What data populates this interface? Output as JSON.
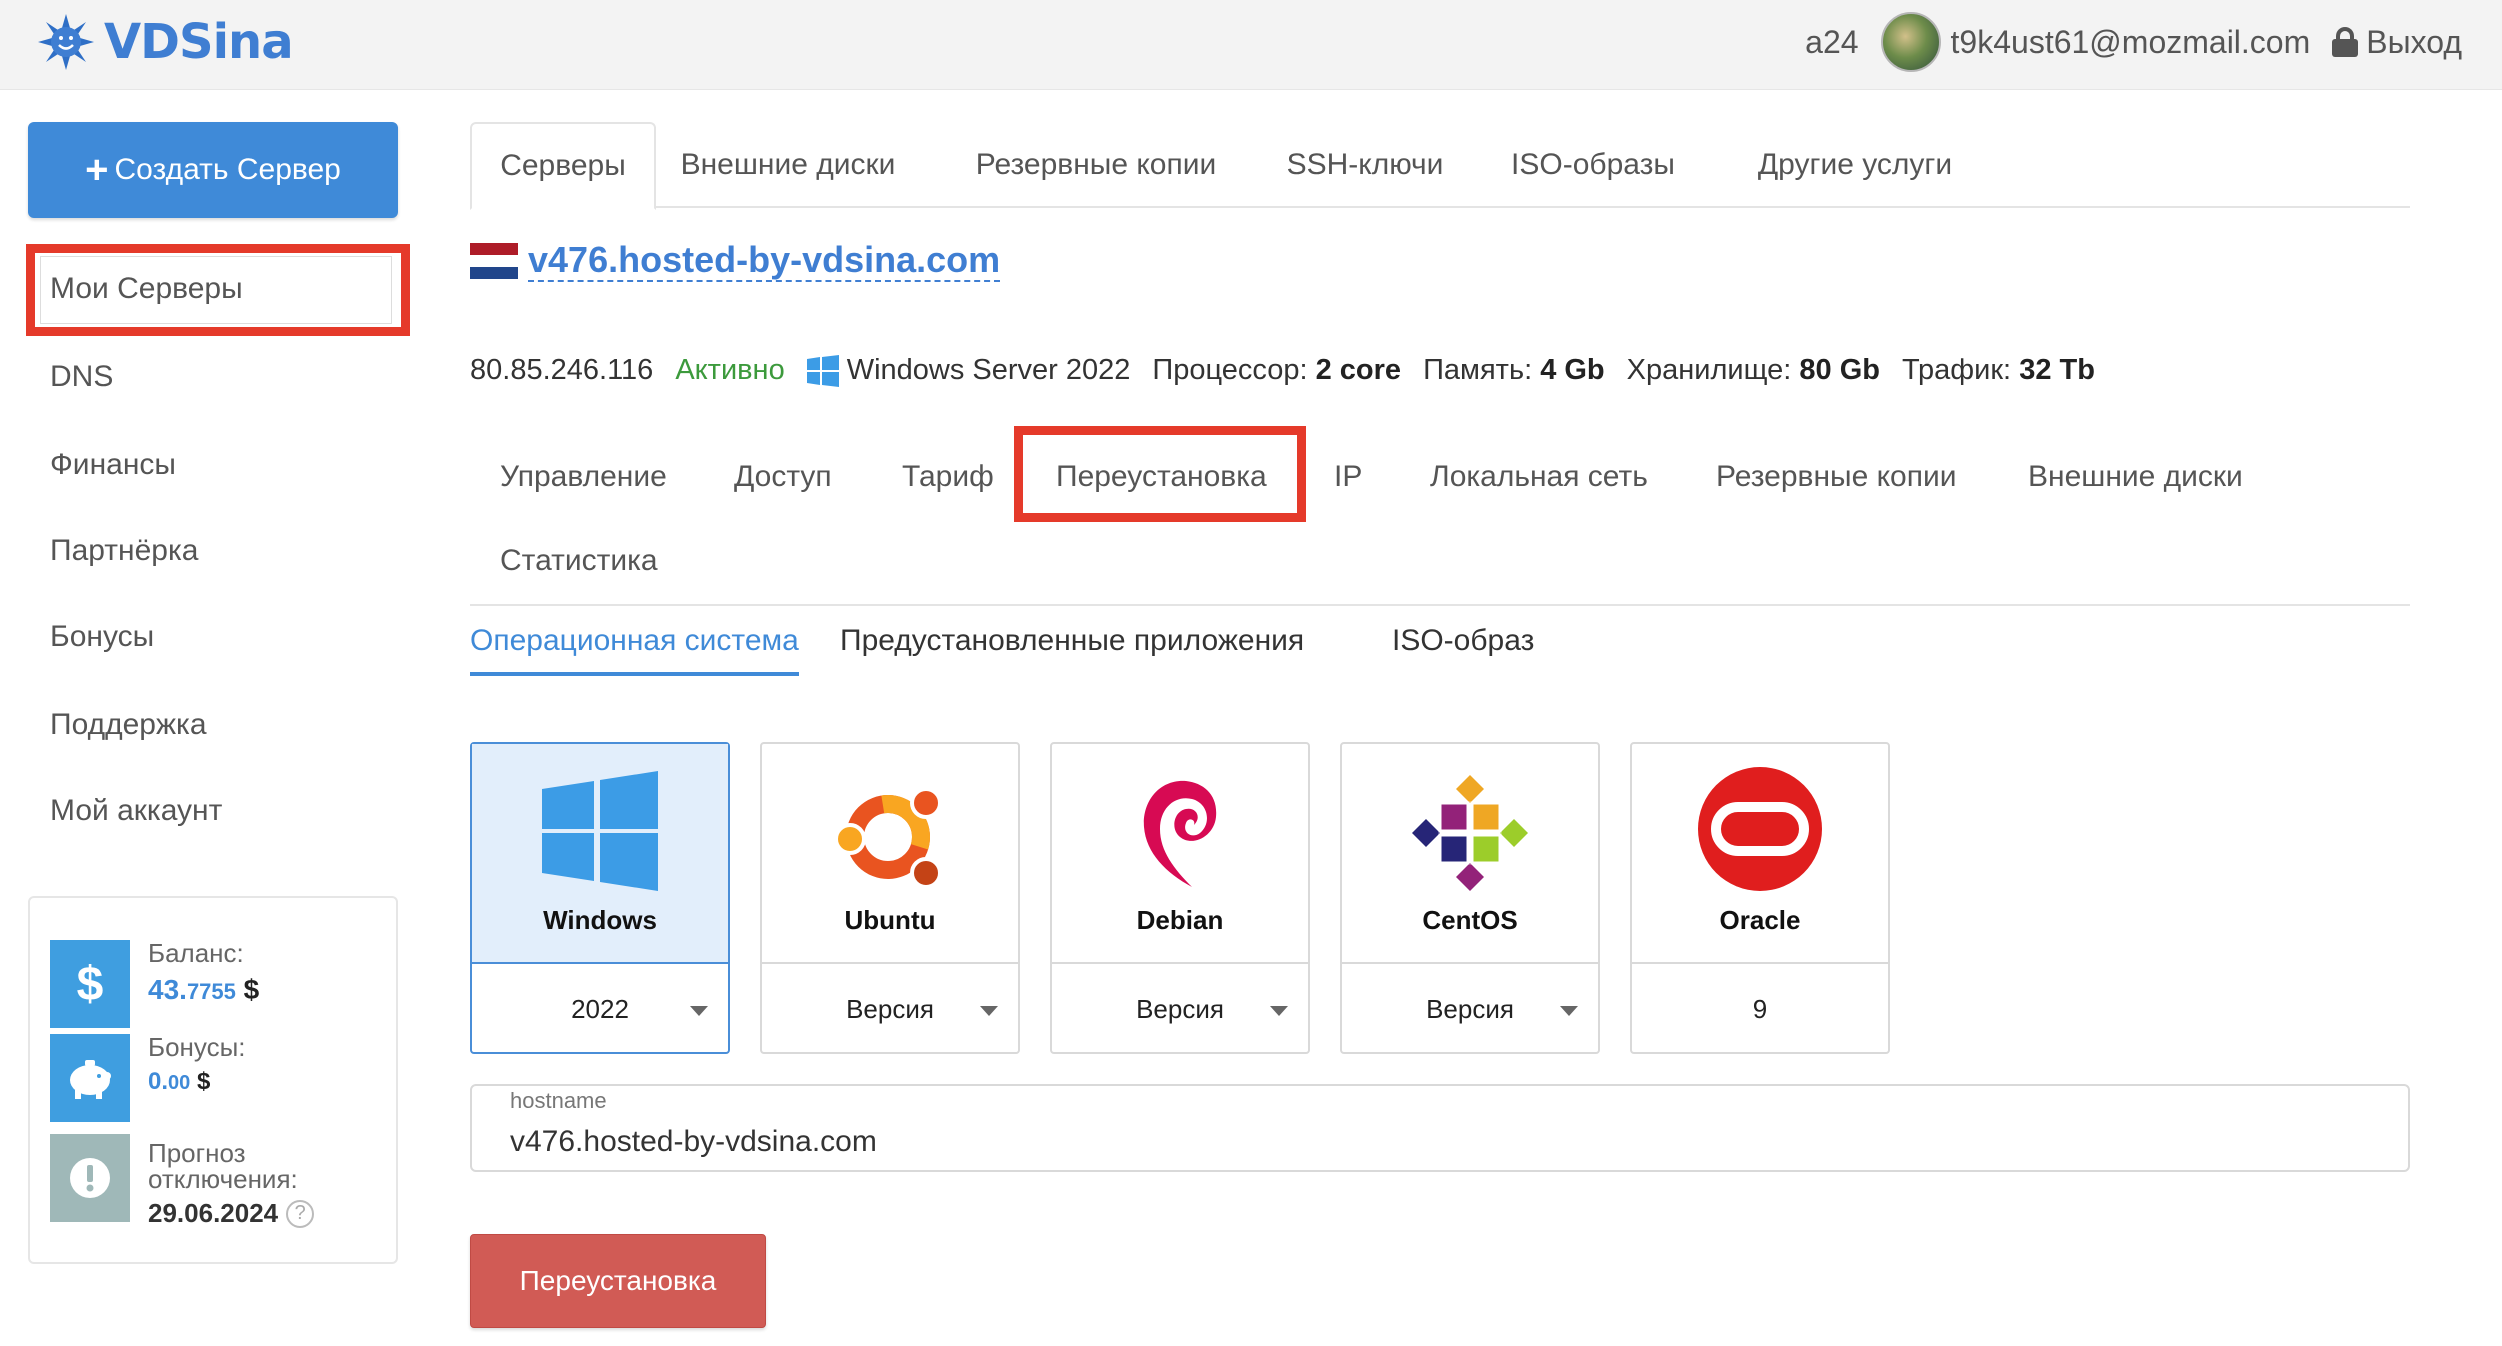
{
  "header": {
    "brand": "VDSina",
    "username": "a24",
    "email": "t9k4ust61@mozmail.com",
    "logout_label": "Выход"
  },
  "sidebar": {
    "create_label": "Создать Сервер",
    "items": [
      {
        "label": "Мои Серверы"
      },
      {
        "label": "DNS"
      },
      {
        "label": "Финансы"
      },
      {
        "label": "Партнёрка"
      },
      {
        "label": "Бонусы"
      },
      {
        "label": "Поддержка"
      },
      {
        "label": "Мой аккаунт"
      }
    ],
    "balance": {
      "balance_label": "Баланс:",
      "balance_main": "43.",
      "balance_frac": "7755",
      "currency": "$",
      "bonus_label": "Бонусы:",
      "bonus_main": "0.",
      "bonus_frac": "00",
      "forecast_label_1": "Прогноз",
      "forecast_label_2": "отключения:",
      "forecast_date": "29.06.2024",
      "help": "?"
    }
  },
  "top_tabs": [
    "Серверы",
    "Внешние диски",
    "Резервные копии",
    "SSH-ключи",
    "ISO-образы",
    "Другие услуги"
  ],
  "server": {
    "hostname": "v476.hosted-by-vdsina.com",
    "ip": "80.85.246.116",
    "status": "Активно",
    "os": "Windows Server 2022",
    "cpu_label": "Процессор:",
    "cpu_value": "2 core",
    "ram_label": "Память:",
    "ram_value": "4 Gb",
    "storage_label": "Хранилище:",
    "storage_value": "80 Gb",
    "traffic_label": "Трафик:",
    "traffic_value": "32 Tb"
  },
  "server_tabs": [
    "Управление",
    "Доступ",
    "Тариф",
    "Переустановка",
    "IP",
    "Локальная сеть",
    "Резервные копии",
    "Внешние диски",
    "Статистика"
  ],
  "os_tabs": [
    "Операционная система",
    "Предустановленные приложения",
    "ISO-образ"
  ],
  "os_cards": [
    {
      "name": "Windows",
      "version": "2022"
    },
    {
      "name": "Ubuntu",
      "version": "Версия"
    },
    {
      "name": "Debian",
      "version": "Версия"
    },
    {
      "name": "CentOS",
      "version": "Версия"
    },
    {
      "name": "Oracle",
      "version": "9"
    }
  ],
  "hostname_field": {
    "label": "hostname",
    "value": "v476.hosted-by-vdsina.com"
  },
  "reinstall_label": "Переустановка",
  "colors": {
    "accent": "#3f8ad8",
    "highlight": "#e53a2a",
    "danger": "#d15b55",
    "active_status": "#3c9a3c"
  }
}
